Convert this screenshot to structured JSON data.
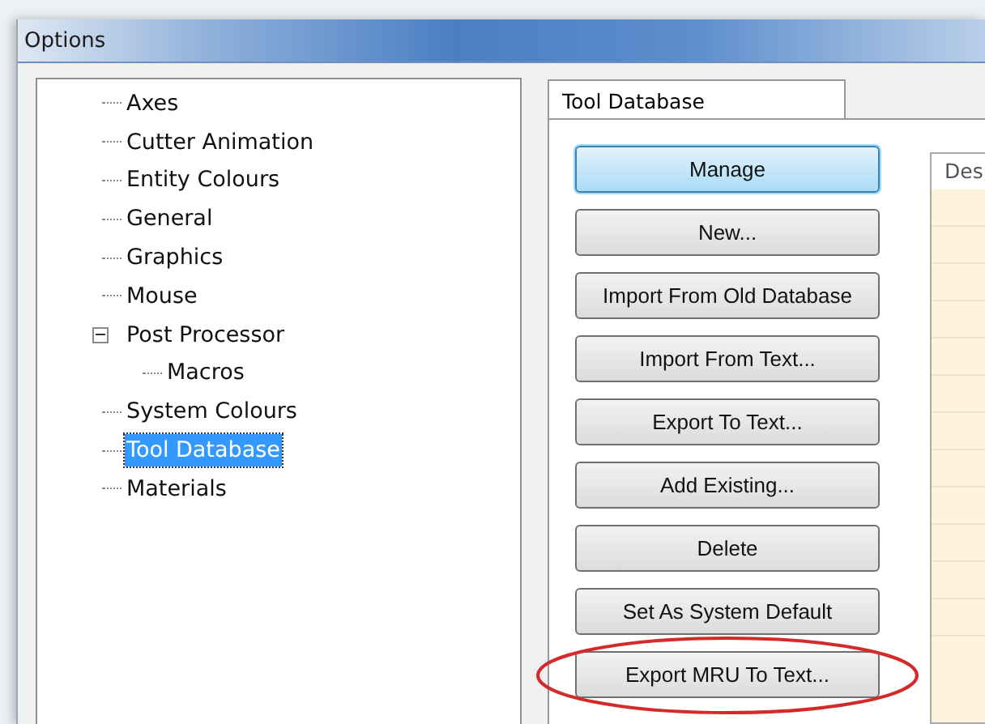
{
  "window": {
    "title": "Options"
  },
  "tree": {
    "items": [
      {
        "label": "Axes",
        "selected": false
      },
      {
        "label": "Cutter Animation",
        "selected": false
      },
      {
        "label": "Entity Colours",
        "selected": false
      },
      {
        "label": "General",
        "selected": false
      },
      {
        "label": "Graphics",
        "selected": false
      },
      {
        "label": "Mouse",
        "selected": false
      },
      {
        "label": "Post Processor",
        "selected": false,
        "expanded": true,
        "children": [
          {
            "label": "Macros",
            "selected": false
          }
        ]
      },
      {
        "label": "System Colours",
        "selected": false
      },
      {
        "label": "Tool Database",
        "selected": true
      },
      {
        "label": "Materials",
        "selected": false
      }
    ]
  },
  "tabs": [
    {
      "label": "Tool Database",
      "selected": true
    }
  ],
  "buttons": [
    {
      "label": "Manage",
      "default": true,
      "highlighted": false
    },
    {
      "label": "New...",
      "default": false,
      "highlighted": false
    },
    {
      "label": "Import From Old Database",
      "default": false,
      "highlighted": false
    },
    {
      "label": "Import From Text...",
      "default": false,
      "highlighted": false
    },
    {
      "label": "Export To Text...",
      "default": false,
      "highlighted": false
    },
    {
      "label": "Add Existing...",
      "default": false,
      "highlighted": false
    },
    {
      "label": "Delete",
      "default": false,
      "highlighted": false
    },
    {
      "label": "Set As System Default",
      "default": false,
      "highlighted": false
    },
    {
      "label": "Export MRU To Text...",
      "default": false,
      "highlighted": true
    }
  ],
  "table": {
    "columns": [
      "Des"
    ]
  }
}
